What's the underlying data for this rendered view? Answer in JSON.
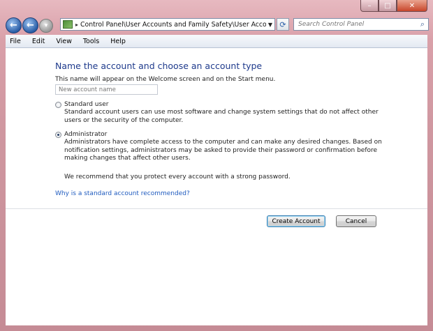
{
  "window": {
    "caption_buttons": {
      "minimize": "–",
      "maximize": "□",
      "close": "✕"
    }
  },
  "nav": {
    "back_icon": "arrow-left",
    "forward_icon": "arrow-right",
    "address_path": "Control Panel\\User Accounts and Family Safety\\User Accounts\\M",
    "search_placeholder": "Search Control Panel"
  },
  "menu": [
    "File",
    "Edit",
    "View",
    "Tools",
    "Help"
  ],
  "main": {
    "heading": "Name the account and choose an account type",
    "description": "This name will appear on the Welcome screen and on the Start menu.",
    "name_placeholder": "New account name",
    "account_types": [
      {
        "label": "Standard user",
        "selected": false,
        "description": "Standard account users can use most software and change system settings that do not affect other users or the security of the computer."
      },
      {
        "label": "Administrator",
        "selected": true,
        "description": "Administrators have complete access to the computer and can make any desired changes. Based on notification settings, administrators may be asked to provide their password or confirmation before making changes that affect other users."
      }
    ],
    "recommendation": "We recommend that you protect every account with a strong password.",
    "help_link": "Why is a standard account recommended?"
  },
  "buttons": {
    "create": "Create Account",
    "cancel": "Cancel"
  }
}
